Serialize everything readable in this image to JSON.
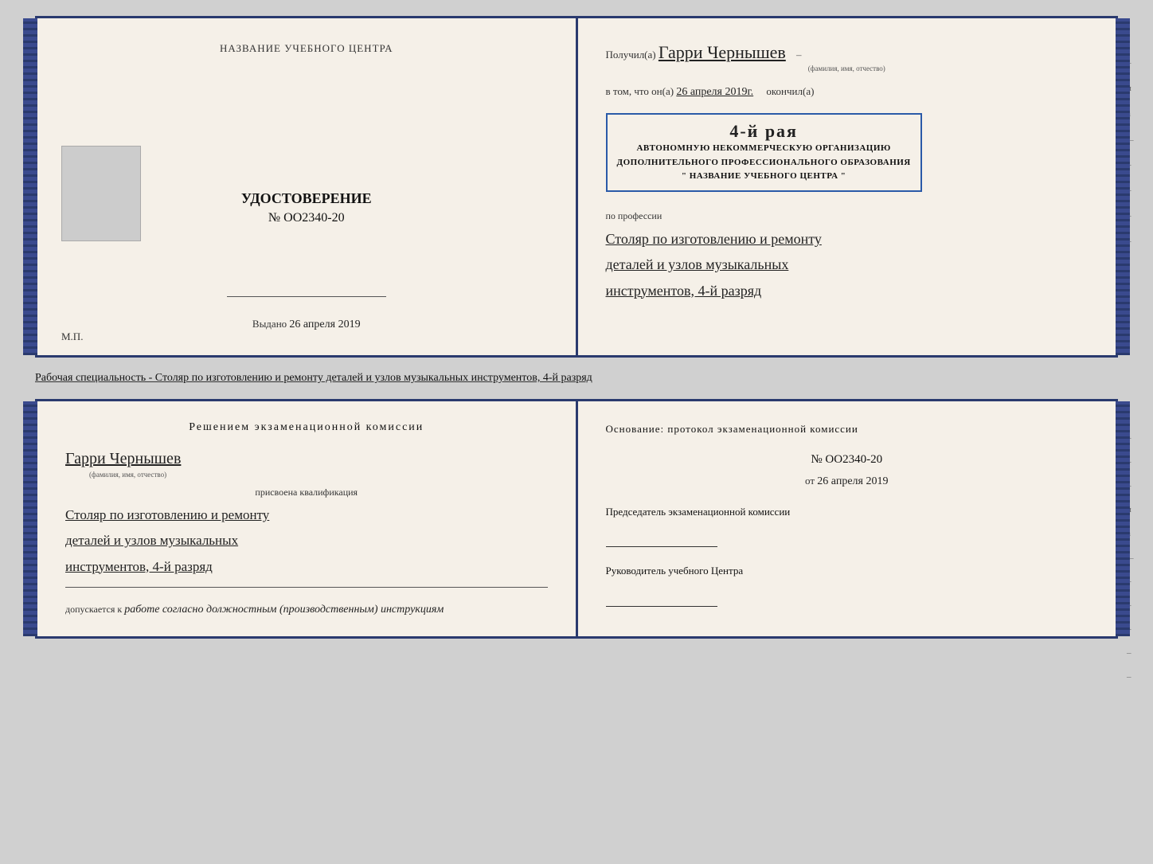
{
  "page": {
    "background_color": "#d0d0d0"
  },
  "top_diploma": {
    "left": {
      "center_title": "НАЗВАНИЕ УЧЕБНОГО ЦЕНТРА",
      "udostoverenie_label": "УДОСТОВЕРЕНИЕ",
      "number": "№ OO2340-20",
      "vydano_label": "Выдано",
      "vydano_date": "26 апреля 2019",
      "mp_label": "М.П."
    },
    "right": {
      "poluchil_label": "Получил(а)",
      "name_handwritten": "Гарри Чернышев",
      "name_hint": "(фамилия, имя, отчество)",
      "vtom_label": "в том, что он(а)",
      "date_handwritten": "26 апреля 2019г.",
      "okончил_label": "окончил(а)",
      "stamp_line1": "4-й рая",
      "stamp_org_line1": "АВТОНОМНУЮ НЕКОММЕРЧЕСКУЮ ОРГАНИЗАЦИЮ",
      "stamp_org_line2": "ДОПОЛНИТЕЛЬНОГО ПРОФЕССИОНАЛЬНОГО ОБРАЗОВАНИЯ",
      "stamp_org_line3": "\" НАЗВАНИЕ УЧЕБНОГО ЦЕНТРА \"",
      "po_professii_label": "по профессии",
      "profession_line1": "Столяр по изготовлению и ремонту",
      "profession_line2": "деталей и узлов музыкальных",
      "profession_line3": "инструментов, 4-й разряд"
    }
  },
  "description_text": "Рабочая специальность - Столяр по изготовлению и ремонту деталей и узлов музыкальных инструментов, 4-й разряд",
  "bottom_book": {
    "left": {
      "resheniem_title": "Решением  экзаменационной  комиссии",
      "name_handwritten": "Гарри Чернышев",
      "name_hint": "(фамилия, имя, отчество)",
      "prisvoena_label": "присвоена квалификация",
      "profession_line1": "Столяр по изготовлению и ремонту",
      "profession_line2": "деталей и узлов музыкальных",
      "profession_line3": "инструментов, 4-й разряд",
      "dopuskaetsya_label": "допускается к",
      "dopuskaetsya_value": "работе согласно должностным (производственным) инструкциям"
    },
    "right": {
      "osnovanie_title": "Основание: протокол экзаменационной  комиссии",
      "number": "№  OO2340-20",
      "ot_label": "от",
      "date": "26 апреля 2019",
      "predsedatel_label": "Председатель экзаменационной комиссии",
      "rukovoditel_label": "Руководитель учебного Центра"
    }
  }
}
